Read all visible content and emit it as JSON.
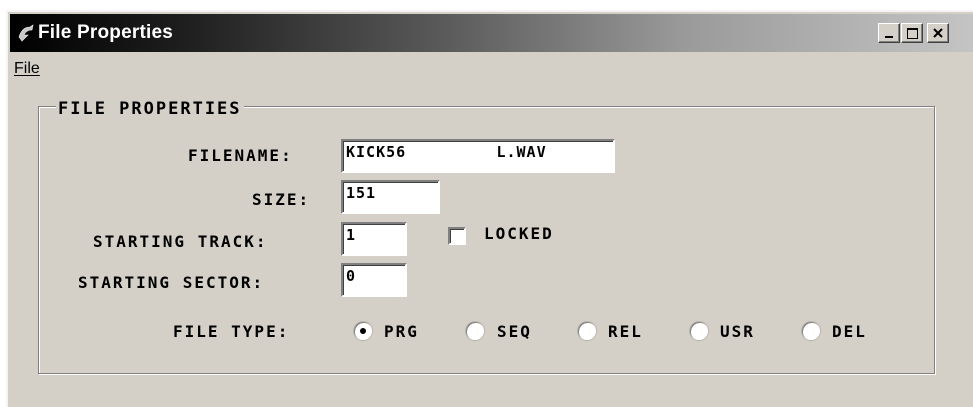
{
  "window": {
    "title": "File Properties",
    "icon": "app-icon",
    "controls": [
      "minimize-icon",
      "maximize-icon",
      "close-icon"
    ]
  },
  "menubar": {
    "items": [
      {
        "label": "File"
      }
    ]
  },
  "group": {
    "label": "FILE PROPERTIES"
  },
  "form": {
    "filename_label": "FILENAME:",
    "filename_value": "KICK56         L.WAV",
    "size_label": "SIZE:",
    "size_value": "151",
    "starting_track_label": "STARTING TRACK:",
    "starting_track_value": "1",
    "starting_sector_label": "STARTING SECTOR:",
    "starting_sector_value": "0",
    "locked_label": "LOCKED",
    "locked_checked": false,
    "file_type_label": "FILE TYPE:",
    "file_types": [
      {
        "label": "PRG",
        "checked": true
      },
      {
        "label": "SEQ",
        "checked": false
      },
      {
        "label": "REL",
        "checked": false
      },
      {
        "label": "USR",
        "checked": false
      },
      {
        "label": "DEL",
        "checked": false
      }
    ]
  }
}
